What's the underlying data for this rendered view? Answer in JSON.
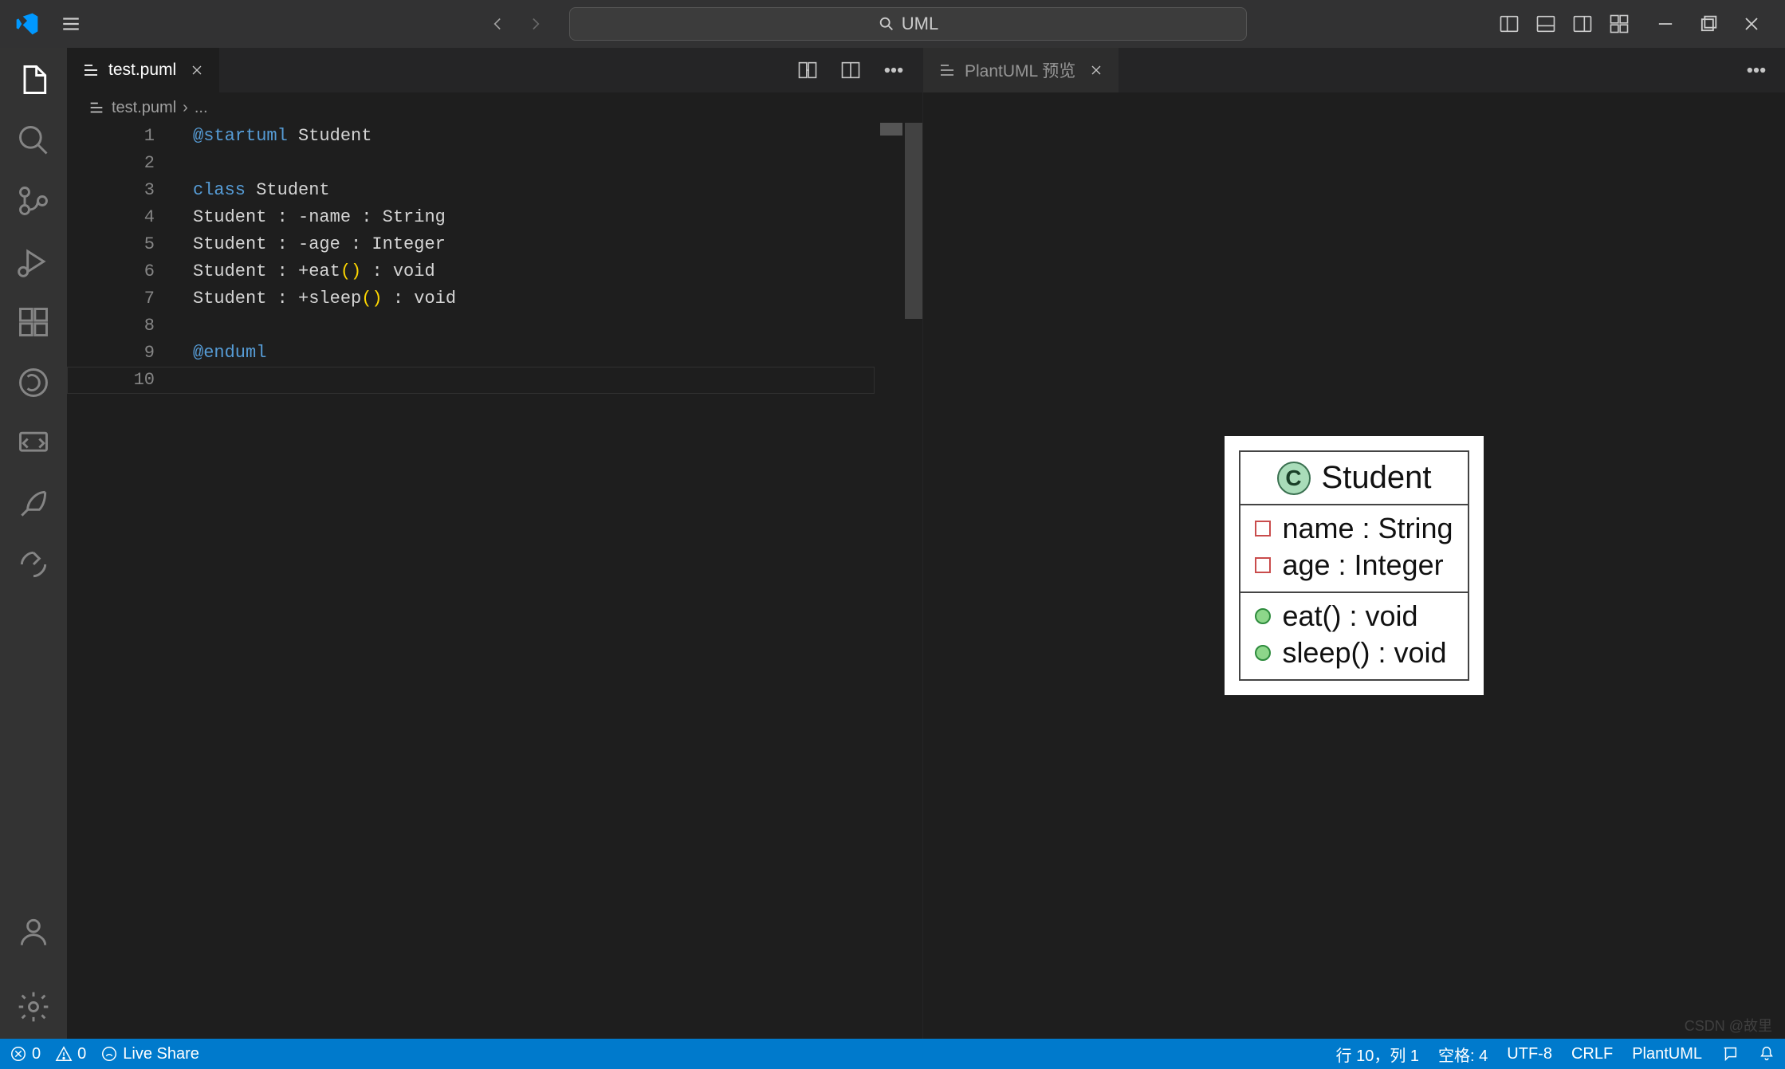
{
  "titlebar": {
    "command_text": "UML"
  },
  "tabs": {
    "left": {
      "file": "test.puml"
    },
    "right": {
      "title": "PlantUML 预览"
    }
  },
  "breadcrumb": {
    "file": "test.puml",
    "rest": "..."
  },
  "code": {
    "lines": [
      {
        "n": "1",
        "tokens": [
          [
            "dir",
            "@startuml"
          ],
          [
            "txt",
            " Student"
          ]
        ]
      },
      {
        "n": "2",
        "tokens": []
      },
      {
        "n": "3",
        "tokens": [
          [
            "kw",
            "class"
          ],
          [
            "txt",
            " Student"
          ]
        ]
      },
      {
        "n": "4",
        "tokens": [
          [
            "txt",
            "Student : -name : String"
          ]
        ]
      },
      {
        "n": "5",
        "tokens": [
          [
            "txt",
            "Student : -age : Integer"
          ]
        ]
      },
      {
        "n": "6",
        "tokens": [
          [
            "txt",
            "Student : +eat"
          ],
          [
            "par",
            "()"
          ],
          [
            "txt",
            " : void"
          ]
        ]
      },
      {
        "n": "7",
        "tokens": [
          [
            "txt",
            "Student : +sleep"
          ],
          [
            "par",
            "()"
          ],
          [
            "txt",
            " : void"
          ]
        ]
      },
      {
        "n": "8",
        "tokens": []
      },
      {
        "n": "9",
        "tokens": [
          [
            "dir",
            "@enduml"
          ]
        ]
      },
      {
        "n": "10",
        "tokens": []
      }
    ]
  },
  "uml": {
    "class_letter": "C",
    "class_name": "Student",
    "attributes": [
      {
        "vis": "private",
        "text": "name : String"
      },
      {
        "vis": "private",
        "text": "age : Integer"
      }
    ],
    "methods": [
      {
        "vis": "public",
        "text": "eat() : void"
      },
      {
        "vis": "public",
        "text": "sleep() : void"
      }
    ]
  },
  "status": {
    "errors": "0",
    "warnings": "0",
    "live_share": "Live Share",
    "cursor": "行 10，列 1",
    "indent": "空格: 4",
    "encoding": "UTF-8",
    "eol": "CRLF",
    "lang": "PlantUML"
  },
  "watermark": "CSDN @故里"
}
